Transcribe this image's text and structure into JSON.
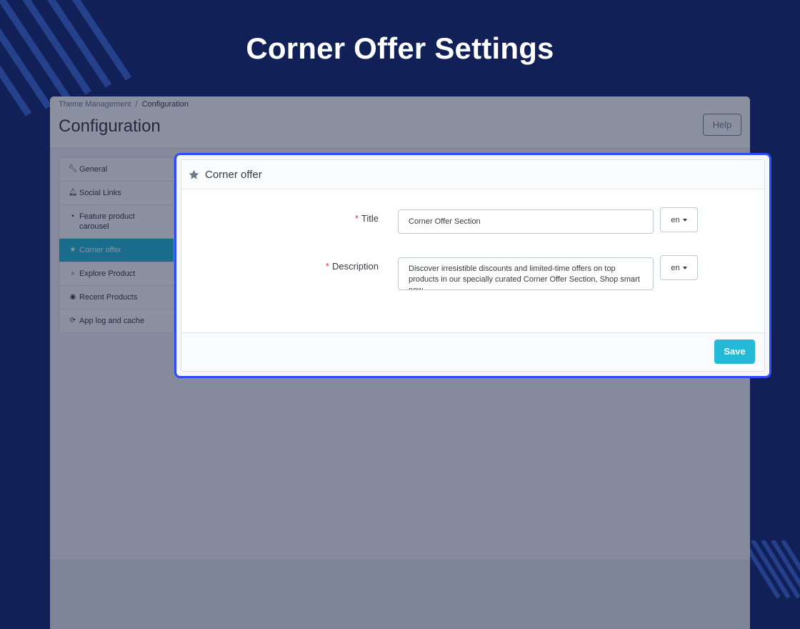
{
  "banner": {
    "heading": "Corner Offer Settings"
  },
  "admin": {
    "breadcrumb": {
      "parent": "Theme Management",
      "separator": "/",
      "current": "Configuration"
    },
    "page_title": "Configuration",
    "help_label": "Help",
    "sidebar": {
      "items": [
        {
          "label": "General",
          "icon": "wrench-icon"
        },
        {
          "label": "Social Links",
          "icon": "bell-icon"
        },
        {
          "label": "Feature product carousel",
          "icon": "archive-icon"
        },
        {
          "label": "Corner offer",
          "icon": "star-icon",
          "active": true
        },
        {
          "label": "Explore Product",
          "icon": "search-icon"
        },
        {
          "label": "Recent Products",
          "icon": "eye-icon"
        },
        {
          "label": "App log and cache",
          "icon": "refresh-icon"
        }
      ]
    }
  },
  "panel": {
    "title": "Corner offer",
    "fields": {
      "title": {
        "label": "Title",
        "required_mark": "*",
        "value": "Corner Offer Section",
        "lang": "en"
      },
      "description": {
        "label": "Description",
        "required_mark": "*",
        "value": "Discover irresistible discounts and limited-time offers on top products in our specially curated Corner Offer Section, Shop smart now",
        "lang": "en"
      }
    },
    "save_label": "Save"
  },
  "colors": {
    "background": "#112056",
    "accent": "#25b9d7",
    "focus_border": "#2c4bff",
    "required": "#e53935"
  }
}
